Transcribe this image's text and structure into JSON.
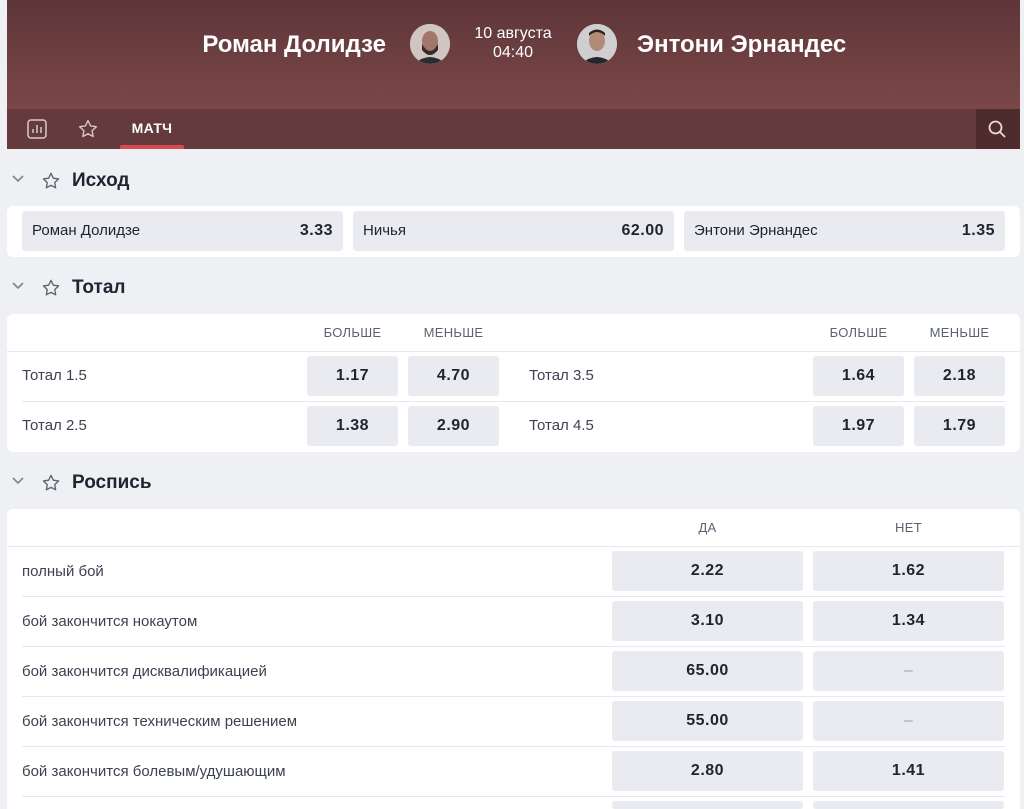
{
  "header": {
    "fighter_left": "Роман Долидзе",
    "fighter_right": "Энтони Эрнандес",
    "date": "10 августа",
    "time": "04:40"
  },
  "nav": {
    "tab_match": "МАТЧ"
  },
  "outcome": {
    "title": "Исход",
    "options": [
      {
        "label": "Роман Долидзе",
        "value": "3.33"
      },
      {
        "label": "Ничья",
        "value": "62.00"
      },
      {
        "label": "Энтони Эрнандес",
        "value": "1.35"
      }
    ]
  },
  "total": {
    "title": "Тотал",
    "over_label": "БОЛЬШЕ",
    "under_label": "МЕНЬШЕ",
    "left_rows": [
      {
        "label": "Тотал 1.5",
        "over": "1.17",
        "under": "4.70"
      },
      {
        "label": "Тотал 2.5",
        "over": "1.38",
        "under": "2.90"
      }
    ],
    "right_rows": [
      {
        "label": "Тотал 3.5",
        "over": "1.64",
        "under": "2.18"
      },
      {
        "label": "Тотал 4.5",
        "over": "1.97",
        "under": "1.79"
      }
    ]
  },
  "rospis": {
    "title": "Роспись",
    "yes_label": "ДА",
    "no_label": "НЕТ",
    "rows": [
      {
        "label": "полный бой",
        "yes": "2.22",
        "no": "1.62"
      },
      {
        "label": "бой закончится нокаутом",
        "yes": "3.10",
        "no": "1.34"
      },
      {
        "label": "бой закончится дисквалификацией",
        "yes": "65.00",
        "no": "–"
      },
      {
        "label": "бой закончится техническим решением",
        "yes": "55.00",
        "no": "–"
      },
      {
        "label": "бой закончится болевым/удушающим",
        "yes": "2.80",
        "no": "1.41"
      }
    ]
  }
}
